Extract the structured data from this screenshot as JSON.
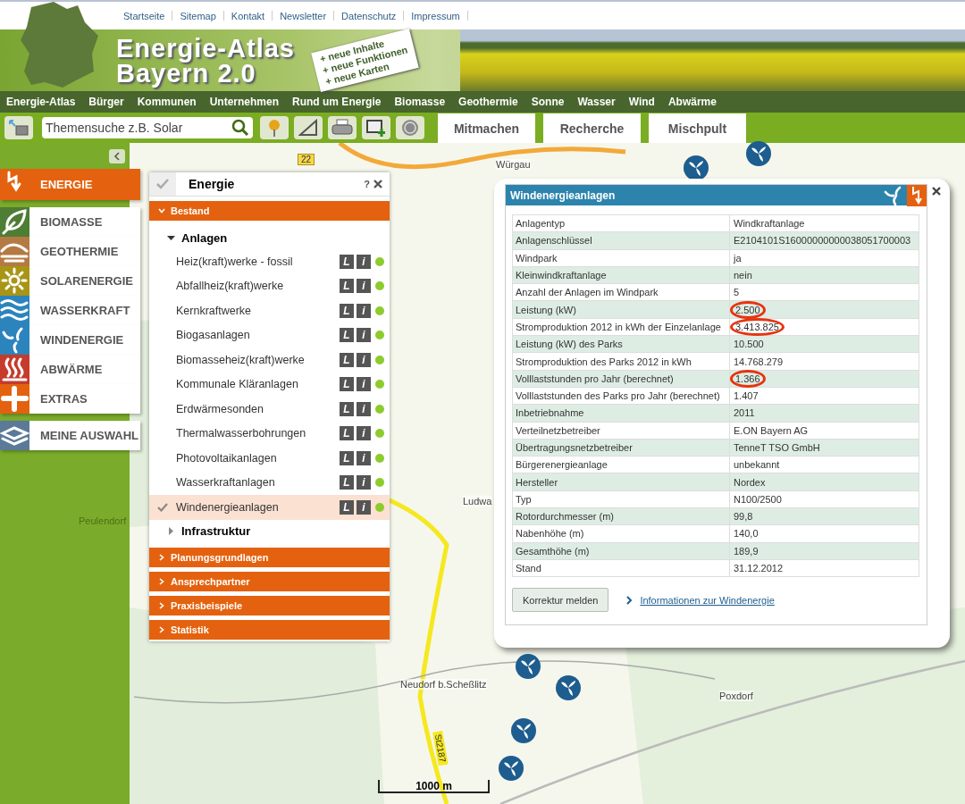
{
  "top_links": [
    "Startseite",
    "Sitemap",
    "Kontakt",
    "Newsletter",
    "Datenschutz",
    "Impressum"
  ],
  "banner": {
    "title_lines": [
      "Energie-Atlas",
      "Bayern 2.0"
    ],
    "sticker_lines": [
      "+ neue Inhalte",
      "+ neue Funktionen",
      "+ neue Karten"
    ]
  },
  "main_nav": [
    "Energie-Atlas",
    "Bürger",
    "Kommunen",
    "Unternehmen",
    "Rund um Energie",
    "Biomasse",
    "Geothermie",
    "Sonne",
    "Wasser",
    "Wind",
    "Abwärme"
  ],
  "toolbar": {
    "search": {
      "placeholder": "Themensuche z.B. Solar"
    },
    "tabs": [
      "Mitmachen",
      "Recherche",
      "Mischpult"
    ]
  },
  "categories": [
    {
      "label": "ENERGIE",
      "kind": "energy",
      "color": "#e4620f",
      "selected": true
    },
    {
      "label": "BIOMASSE",
      "kind": "leaf",
      "color": "#4e7d34",
      "selected": false
    },
    {
      "label": "GEOTHERMIE",
      "kind": "hills",
      "color": "#b57a43",
      "selected": false
    },
    {
      "label": "SOLARENERGIE",
      "kind": "sun",
      "color": "#a89516",
      "selected": false
    },
    {
      "label": "WASSERKRAFT",
      "kind": "waves",
      "color": "#2c84bd",
      "selected": false
    },
    {
      "label": "WINDENERGIE",
      "kind": "wind",
      "color": "#2c84bd",
      "selected": false
    },
    {
      "label": "ABWÄRME",
      "kind": "heat",
      "color": "#c63b2c",
      "selected": false
    },
    {
      "label": "EXTRAS",
      "kind": "plus",
      "color": "#e4620f",
      "selected": false
    },
    {
      "label": "MEINE AUSWAHL",
      "kind": "layers",
      "color": "#5b7a98",
      "selected": false
    }
  ],
  "layer_panel": {
    "title": "Energie",
    "help": "?",
    "sections": [
      {
        "label": "Bestand",
        "expanded": true,
        "children": [
          {
            "label": "Anlagen",
            "expanded": true,
            "children": [
              {
                "label": "Heiz(kraft)werke - fossil",
                "checked": false,
                "legend": "L",
                "info": "i"
              },
              {
                "label": "Abfallheiz(kraft)werke",
                "checked": false,
                "legend": "L",
                "info": "i"
              },
              {
                "label": "Kernkraftwerke",
                "checked": false,
                "legend": "L",
                "info": "i"
              },
              {
                "label": "Biogasanlagen",
                "checked": false,
                "legend": "L",
                "info": "i"
              },
              {
                "label": "Biomasseheiz(kraft)werke",
                "checked": false,
                "legend": "L",
                "info": "i"
              },
              {
                "label": "Kommunale Kläranlagen",
                "checked": false,
                "legend": "L",
                "info": "i"
              },
              {
                "label": "Erdwärmesonden",
                "checked": false,
                "legend": "L",
                "info": "i"
              },
              {
                "label": "Thermalwasserbohrungen",
                "checked": false,
                "legend": "L",
                "info": "i"
              },
              {
                "label": "Photovoltaikanlagen",
                "checked": false,
                "legend": "L",
                "info": "i"
              },
              {
                "label": "Wasserkraftanlagen",
                "checked": false,
                "legend": "L",
                "info": "i"
              },
              {
                "label": "Windenergieanlagen",
                "checked": true,
                "legend": "L",
                "info": "i"
              }
            ]
          },
          {
            "label": "Infrastruktur",
            "expanded": false
          }
        ]
      },
      {
        "label": "Planungsgrundlagen",
        "expanded": false
      },
      {
        "label": "Ansprechpartner",
        "expanded": false
      },
      {
        "label": "Praxisbeispiele",
        "expanded": false
      },
      {
        "label": "Statistik",
        "expanded": false
      }
    ]
  },
  "map": {
    "labels": [
      "Würgau",
      "Ludwa",
      "Neudorf b.Scheßlitz",
      "Poxdorf",
      "Peulendorf"
    ],
    "road_signs": [
      "22",
      "St2187"
    ],
    "scale": "1000 m"
  },
  "popup": {
    "title": "Windenergieanlagen",
    "rows": [
      {
        "label": "Anlagentyp",
        "value": "Windkraftanlage",
        "highlighted": false
      },
      {
        "label": "Anlagenschlüssel",
        "value": "E2104101S16000000000038051700003",
        "highlighted": false
      },
      {
        "label": "Windpark",
        "value": "ja",
        "highlighted": false
      },
      {
        "label": "Kleinwindkraftanlage",
        "value": "nein",
        "highlighted": false
      },
      {
        "label": "Anzahl der Anlagen im Windpark",
        "value": "5",
        "highlighted": false
      },
      {
        "label": "Leistung (kW)",
        "value": "2.500",
        "highlighted": true
      },
      {
        "label": "Stromproduktion 2012 in kWh der Einzelanlage",
        "value": "3.413.825",
        "highlighted": true
      },
      {
        "label": "Leistung (kW) des Parks",
        "value": "10.500",
        "highlighted": false
      },
      {
        "label": "Stromproduktion des Parks 2012 in kWh",
        "value": "14.768.279",
        "highlighted": false
      },
      {
        "label": "Volllaststunden pro Jahr (berechnet)",
        "value": "1.366",
        "highlighted": true
      },
      {
        "label": "Volllaststunden des Parks pro Jahr (berechnet)",
        "value": "1.407",
        "highlighted": false
      },
      {
        "label": "Inbetriebnahme",
        "value": "2011",
        "highlighted": false
      },
      {
        "label": "Verteilnetzbetreiber",
        "value": "E.ON Bayern AG",
        "highlighted": false
      },
      {
        "label": "Übertragungsnetzbetreiber",
        "value": "TenneT TSO GmbH",
        "highlighted": false
      },
      {
        "label": "Bürgerenergieanlage",
        "value": "unbekannt",
        "highlighted": false
      },
      {
        "label": "Hersteller",
        "value": "Nordex",
        "highlighted": false
      },
      {
        "label": "Typ",
        "value": "N100/2500",
        "highlighted": false
      },
      {
        "label": "Rotordurchmesser (m)",
        "value": "99,8",
        "highlighted": false
      },
      {
        "label": "Nabenhöhe (m)",
        "value": "140,0",
        "highlighted": false
      },
      {
        "label": "Gesamthöhe (m)",
        "value": "189,9",
        "highlighted": false
      },
      {
        "label": "Stand",
        "value": "31.12.2012",
        "highlighted": false
      }
    ],
    "button": "Korrektur melden",
    "link": "Informationen zur Windenergie"
  }
}
